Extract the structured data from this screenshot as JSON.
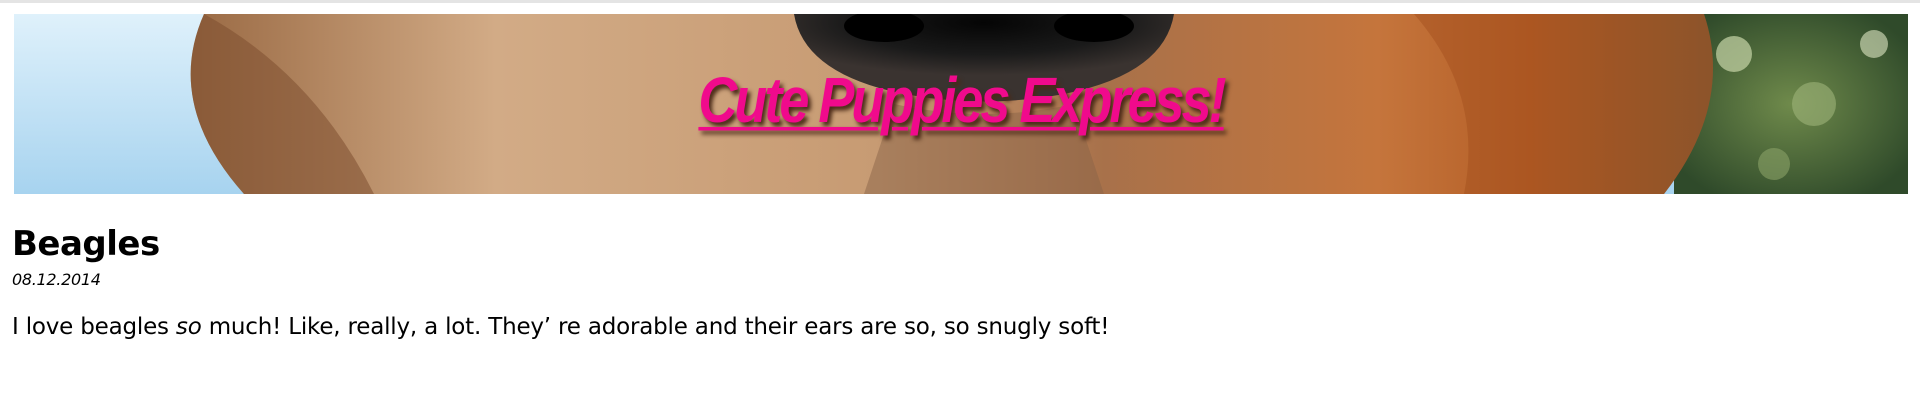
{
  "header": {
    "title": "Cute Puppies Express!",
    "title_color": "#f00a8c",
    "banner_image": "close-up photo of a golden puppy's nose and muzzle"
  },
  "post": {
    "title": "Beagles",
    "date": "08.12.2014",
    "body_before": "I love beagles ",
    "body_emphasis": "so",
    "body_after": " much! Like, really, a lot. They’  re adorable and their ears are so, so snugly soft!"
  }
}
